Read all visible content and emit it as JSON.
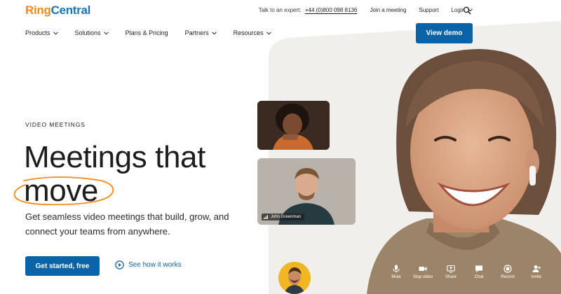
{
  "header": {
    "logo_ring": "Ring",
    "logo_central": "Central",
    "expert_prefix": "Talk to an expert:",
    "expert_phone": "+44 (0)800 098 8136",
    "join_meeting": "Join a meeting",
    "support": "Support",
    "login": "Login"
  },
  "nav": {
    "items": [
      {
        "label": "Products",
        "has_dropdown": true
      },
      {
        "label": "Solutions",
        "has_dropdown": true
      },
      {
        "label": "Plans & Pricing",
        "has_dropdown": false
      },
      {
        "label": "Partners",
        "has_dropdown": true
      },
      {
        "label": "Resources",
        "has_dropdown": true
      }
    ],
    "view_demo": "View demo"
  },
  "hero": {
    "eyebrow": "VIDEO MEETINGS",
    "headline_line1": "Meetings that",
    "headline_line2": "move",
    "subcopy": "Get seamless video meetings that build, grow, and connect your teams from anywhere.",
    "cta_primary": "Get started, free",
    "cta_secondary": "See how it works"
  },
  "participants": {
    "tile2_name": "John Greenman"
  },
  "controls": [
    {
      "label": "Mute",
      "icon": "microphone-icon"
    },
    {
      "label": "Stop video",
      "icon": "video-camera-icon"
    },
    {
      "label": "Share",
      "icon": "share-screen-icon"
    },
    {
      "label": "Chat",
      "icon": "chat-bubble-icon"
    },
    {
      "label": "Record",
      "icon": "record-icon"
    },
    {
      "label": "Invite",
      "icon": "invite-person-icon"
    }
  ],
  "colors": {
    "brand_orange": "#f58a1f",
    "brand_blue": "#1a74b9",
    "button_blue": "#0b63a7",
    "hero_panel": "#f0efec"
  }
}
